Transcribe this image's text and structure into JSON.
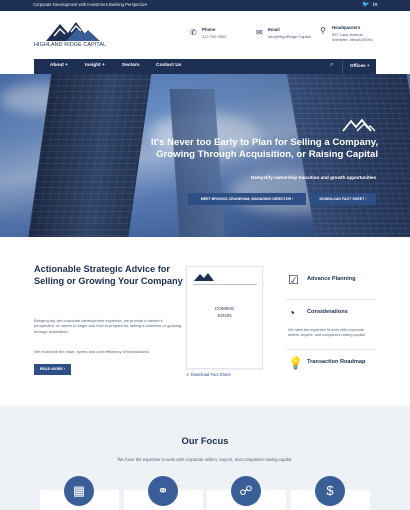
{
  "topbar": {
    "tagline": "Corporate Development with Investment Banking Perspective",
    "twitter_glyph": "🐦",
    "linkedin_glyph": "in"
  },
  "header": {
    "logo_text": "HIGHLAND RIDGE CAPITAL",
    "phone": {
      "label": "Phone",
      "value": "312.799.2500"
    },
    "email": {
      "label": "Email",
      "value": "info@HighRidge Capital"
    },
    "headquarters": {
      "label": "Headquarters",
      "line1": "837 Lake Avenue",
      "line2": "Wilmette, Illinois 60091"
    }
  },
  "nav": {
    "items": [
      "About +",
      "Insight +",
      "Sectors",
      "Contact Us"
    ],
    "offices_label": "Offices +"
  },
  "hero": {
    "headline_1": "It's Never too Early to Plan for Selling a Company,",
    "headline_2": "Growing Through Acquisition, or Raising Capital",
    "subline": "Demystify ownership transition and growth opportunities",
    "button_1": "MEET BROOKS CRANEHAM, MANAGING DIRECTOR  ›",
    "button_2": "DOWNLOAD FACT SHEET  ›"
  },
  "strategy": {
    "title": "Actionable Strategic Advice for Selling or Growing Your Company",
    "paragraph_1": "Bringing top-tier corporate development expertise, we provide a banker's perspective on where to begin and how to prepare for selling a business or growing through acquisition.",
    "paragraph_2": "We maximize the ease, speed and cost efficiency of transactions.",
    "read_more": "READ MORE  ›"
  },
  "factsheet": {
    "coming_soon_1": "COMING",
    "coming_soon_2": "SOON",
    "download_label": "Download Fact Sheet"
  },
  "features": [
    {
      "title": "Advance Planning",
      "description": "",
      "icon": "checklist-icon"
    },
    {
      "title": "Considerations",
      "description": "We have the expertise to work with corporate sellers, buyers, and companies raising capital.",
      "icon": "gauge-icon"
    },
    {
      "title": "Transaction Roadmap",
      "description": "",
      "icon": "lightbulb-icon"
    }
  ],
  "focus": {
    "title": "Our Focus",
    "subtitle": "We have the expertise to work with corporate sellers, buyers, and companies raising capital.",
    "cards": [
      {
        "icon": "building-icon"
      },
      {
        "icon": "handshake-icon"
      },
      {
        "icon": "network-icon"
      },
      {
        "icon": "money-icon"
      }
    ]
  },
  "colors": {
    "navy": "#1d2f52",
    "accent_blue": "#2e4f86",
    "section_bg": "#eef2f7"
  }
}
